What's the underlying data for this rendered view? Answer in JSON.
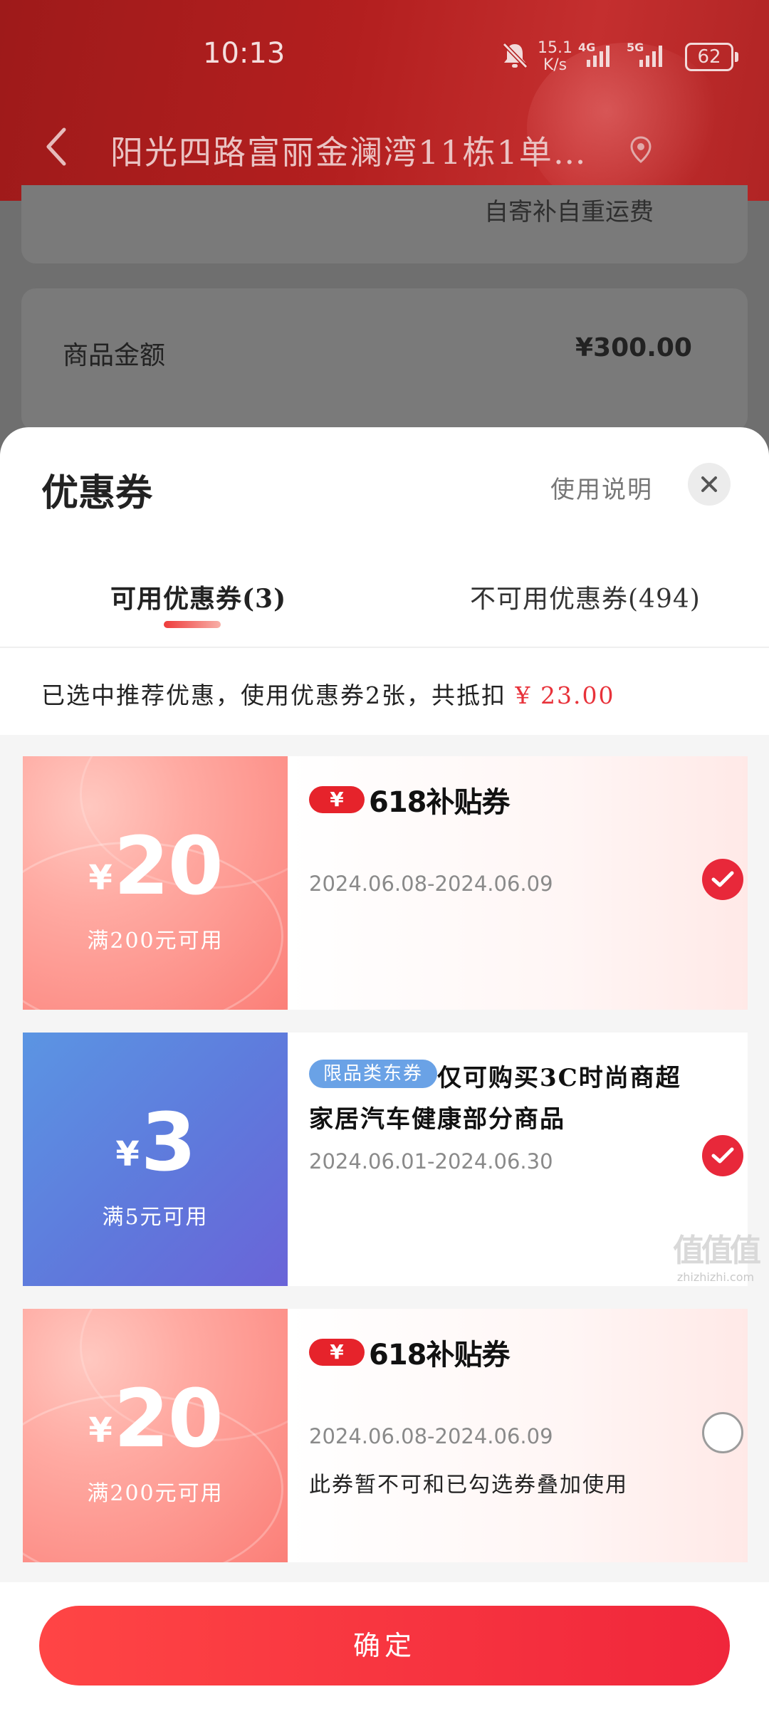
{
  "status_bar": {
    "time": "10:13",
    "net_speed_value": "15.1",
    "net_speed_unit": "K/s",
    "signal_1": "4G",
    "signal_2": "5G",
    "battery": "62"
  },
  "header": {
    "address": "阳光四路富丽金澜湾11栋1单…"
  },
  "background_page": {
    "shipping_note": "自寄补自重运费",
    "goods_amount_label": "商品金额",
    "goods_amount_value": "¥300.00"
  },
  "sheet": {
    "title": "优惠券",
    "help_label": "使用说明",
    "tabs": [
      {
        "label": "可用优惠券(3)",
        "active": true
      },
      {
        "label": "不可用优惠券(494)",
        "active": false
      }
    ],
    "summary_text": "已选中推荐优惠，使用优惠券2张，共抵扣",
    "summary_amount": "¥ 23.00",
    "coupons": [
      {
        "currency": "¥",
        "amount": "20",
        "condition": "满200元可用",
        "badge_symbol": "¥",
        "badge_text": "618补贴券",
        "validity": "2024.06.08-2024.06.09",
        "selected": true,
        "theme": "red"
      },
      {
        "currency": "¥",
        "amount": "3",
        "condition": "满5元可用",
        "category_badge": "限品类东券",
        "scope_line1": "仅可购买3C时尚商超",
        "scope_line2": "家居汽车健康部分商品",
        "validity": "2024.06.01-2024.06.30",
        "selected": true,
        "theme": "blue"
      },
      {
        "currency": "¥",
        "amount": "20",
        "condition": "满200元可用",
        "badge_symbol": "¥",
        "badge_text": "618补贴券",
        "validity": "2024.06.08-2024.06.09",
        "note": "此券暂不可和已勾选券叠加使用",
        "selected": false,
        "theme": "red"
      }
    ],
    "confirm_label": "确定"
  },
  "watermark": {
    "logo": "值值值",
    "url": "zhizhizhi.com"
  },
  "colors": {
    "accent_red": "#e8283a",
    "header_red": "#b31f1f",
    "blue_coupon": "#5f79dc"
  }
}
